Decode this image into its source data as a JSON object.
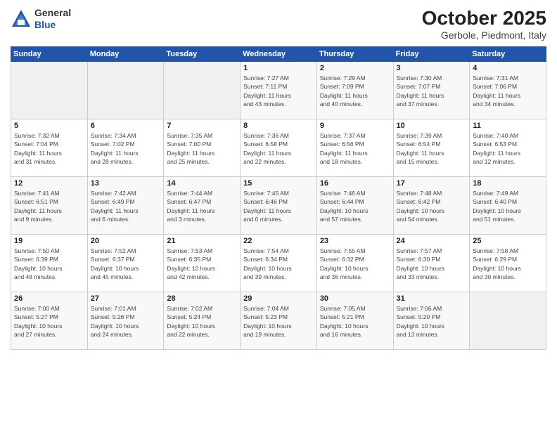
{
  "header": {
    "logo_general": "General",
    "logo_blue": "Blue",
    "month": "October 2025",
    "location": "Gerbole, Piedmont, Italy"
  },
  "weekdays": [
    "Sunday",
    "Monday",
    "Tuesday",
    "Wednesday",
    "Thursday",
    "Friday",
    "Saturday"
  ],
  "weeks": [
    [
      {
        "day": "",
        "info": ""
      },
      {
        "day": "",
        "info": ""
      },
      {
        "day": "",
        "info": ""
      },
      {
        "day": "1",
        "info": "Sunrise: 7:27 AM\nSunset: 7:11 PM\nDaylight: 11 hours\nand 43 minutes."
      },
      {
        "day": "2",
        "info": "Sunrise: 7:29 AM\nSunset: 7:09 PM\nDaylight: 11 hours\nand 40 minutes."
      },
      {
        "day": "3",
        "info": "Sunrise: 7:30 AM\nSunset: 7:07 PM\nDaylight: 11 hours\nand 37 minutes."
      },
      {
        "day": "4",
        "info": "Sunrise: 7:31 AM\nSunset: 7:06 PM\nDaylight: 11 hours\nand 34 minutes."
      }
    ],
    [
      {
        "day": "5",
        "info": "Sunrise: 7:32 AM\nSunset: 7:04 PM\nDaylight: 11 hours\nand 31 minutes."
      },
      {
        "day": "6",
        "info": "Sunrise: 7:34 AM\nSunset: 7:02 PM\nDaylight: 11 hours\nand 28 minutes."
      },
      {
        "day": "7",
        "info": "Sunrise: 7:35 AM\nSunset: 7:00 PM\nDaylight: 11 hours\nand 25 minutes."
      },
      {
        "day": "8",
        "info": "Sunrise: 7:36 AM\nSunset: 6:58 PM\nDaylight: 11 hours\nand 22 minutes."
      },
      {
        "day": "9",
        "info": "Sunrise: 7:37 AM\nSunset: 6:56 PM\nDaylight: 11 hours\nand 18 minutes."
      },
      {
        "day": "10",
        "info": "Sunrise: 7:39 AM\nSunset: 6:54 PM\nDaylight: 11 hours\nand 15 minutes."
      },
      {
        "day": "11",
        "info": "Sunrise: 7:40 AM\nSunset: 6:53 PM\nDaylight: 11 hours\nand 12 minutes."
      }
    ],
    [
      {
        "day": "12",
        "info": "Sunrise: 7:41 AM\nSunset: 6:51 PM\nDaylight: 11 hours\nand 9 minutes."
      },
      {
        "day": "13",
        "info": "Sunrise: 7:42 AM\nSunset: 6:49 PM\nDaylight: 11 hours\nand 6 minutes."
      },
      {
        "day": "14",
        "info": "Sunrise: 7:44 AM\nSunset: 6:47 PM\nDaylight: 11 hours\nand 3 minutes."
      },
      {
        "day": "15",
        "info": "Sunrise: 7:45 AM\nSunset: 6:46 PM\nDaylight: 11 hours\nand 0 minutes."
      },
      {
        "day": "16",
        "info": "Sunrise: 7:46 AM\nSunset: 6:44 PM\nDaylight: 10 hours\nand 57 minutes."
      },
      {
        "day": "17",
        "info": "Sunrise: 7:48 AM\nSunset: 6:42 PM\nDaylight: 10 hours\nand 54 minutes."
      },
      {
        "day": "18",
        "info": "Sunrise: 7:49 AM\nSunset: 6:40 PM\nDaylight: 10 hours\nand 51 minutes."
      }
    ],
    [
      {
        "day": "19",
        "info": "Sunrise: 7:50 AM\nSunset: 6:39 PM\nDaylight: 10 hours\nand 48 minutes."
      },
      {
        "day": "20",
        "info": "Sunrise: 7:52 AM\nSunset: 6:37 PM\nDaylight: 10 hours\nand 45 minutes."
      },
      {
        "day": "21",
        "info": "Sunrise: 7:53 AM\nSunset: 6:35 PM\nDaylight: 10 hours\nand 42 minutes."
      },
      {
        "day": "22",
        "info": "Sunrise: 7:54 AM\nSunset: 6:34 PM\nDaylight: 10 hours\nand 39 minutes."
      },
      {
        "day": "23",
        "info": "Sunrise: 7:55 AM\nSunset: 6:32 PM\nDaylight: 10 hours\nand 36 minutes."
      },
      {
        "day": "24",
        "info": "Sunrise: 7:57 AM\nSunset: 6:30 PM\nDaylight: 10 hours\nand 33 minutes."
      },
      {
        "day": "25",
        "info": "Sunrise: 7:58 AM\nSunset: 6:29 PM\nDaylight: 10 hours\nand 30 minutes."
      }
    ],
    [
      {
        "day": "26",
        "info": "Sunrise: 7:00 AM\nSunset: 5:27 PM\nDaylight: 10 hours\nand 27 minutes."
      },
      {
        "day": "27",
        "info": "Sunrise: 7:01 AM\nSunset: 5:26 PM\nDaylight: 10 hours\nand 24 minutes."
      },
      {
        "day": "28",
        "info": "Sunrise: 7:02 AM\nSunset: 5:24 PM\nDaylight: 10 hours\nand 22 minutes."
      },
      {
        "day": "29",
        "info": "Sunrise: 7:04 AM\nSunset: 5:23 PM\nDaylight: 10 hours\nand 19 minutes."
      },
      {
        "day": "30",
        "info": "Sunrise: 7:05 AM\nSunset: 5:21 PM\nDaylight: 10 hours\nand 16 minutes."
      },
      {
        "day": "31",
        "info": "Sunrise: 7:06 AM\nSunset: 5:20 PM\nDaylight: 10 hours\nand 13 minutes."
      },
      {
        "day": "",
        "info": ""
      }
    ]
  ]
}
